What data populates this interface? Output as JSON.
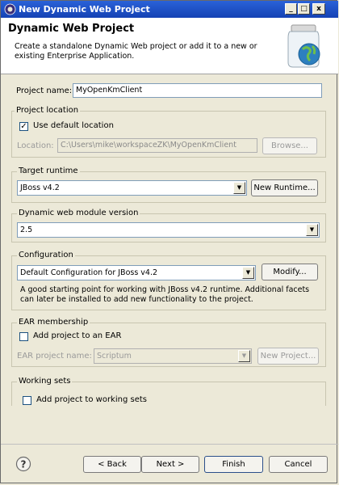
{
  "window": {
    "title": "New Dynamic Web Project"
  },
  "header": {
    "title": "Dynamic Web Project",
    "description": "Create a standalone Dynamic Web project or add it to a new or existing Enterprise Application."
  },
  "project_name": {
    "label": "Project name:",
    "value": "MyOpenKmClient"
  },
  "project_location": {
    "legend": "Project location",
    "use_default_label": "Use default location",
    "use_default_checked": true,
    "location_label": "Location:",
    "location_value": "C:\\Users\\mike\\workspaceZK\\MyOpenKmClient",
    "browse_label": "Browse..."
  },
  "target_runtime": {
    "legend": "Target runtime",
    "value": "JBoss v4.2",
    "new_runtime_label": "New Runtime..."
  },
  "module_version": {
    "legend": "Dynamic web module version",
    "value": "2.5"
  },
  "configuration": {
    "legend": "Configuration",
    "value": "Default Configuration for JBoss v4.2",
    "modify_label": "Modify...",
    "description": "A good starting point for working with JBoss v4.2 runtime. Additional facets can later be installed to add new functionality to the project."
  },
  "ear_membership": {
    "legend": "EAR membership",
    "add_label": "Add project to an EAR",
    "add_checked": false,
    "name_label": "EAR project name:",
    "name_value": "Scriptum",
    "new_project_label": "New Project..."
  },
  "working_sets": {
    "legend": "Working sets",
    "add_label": "Add project to working sets",
    "add_checked": false
  },
  "footer": {
    "help_icon": "help-icon",
    "back_label": "< Back",
    "next_label": "Next >",
    "finish_label": "Finish",
    "cancel_label": "Cancel"
  },
  "title_buttons": {
    "minimize": "_",
    "maximize": "□",
    "close": "x"
  }
}
